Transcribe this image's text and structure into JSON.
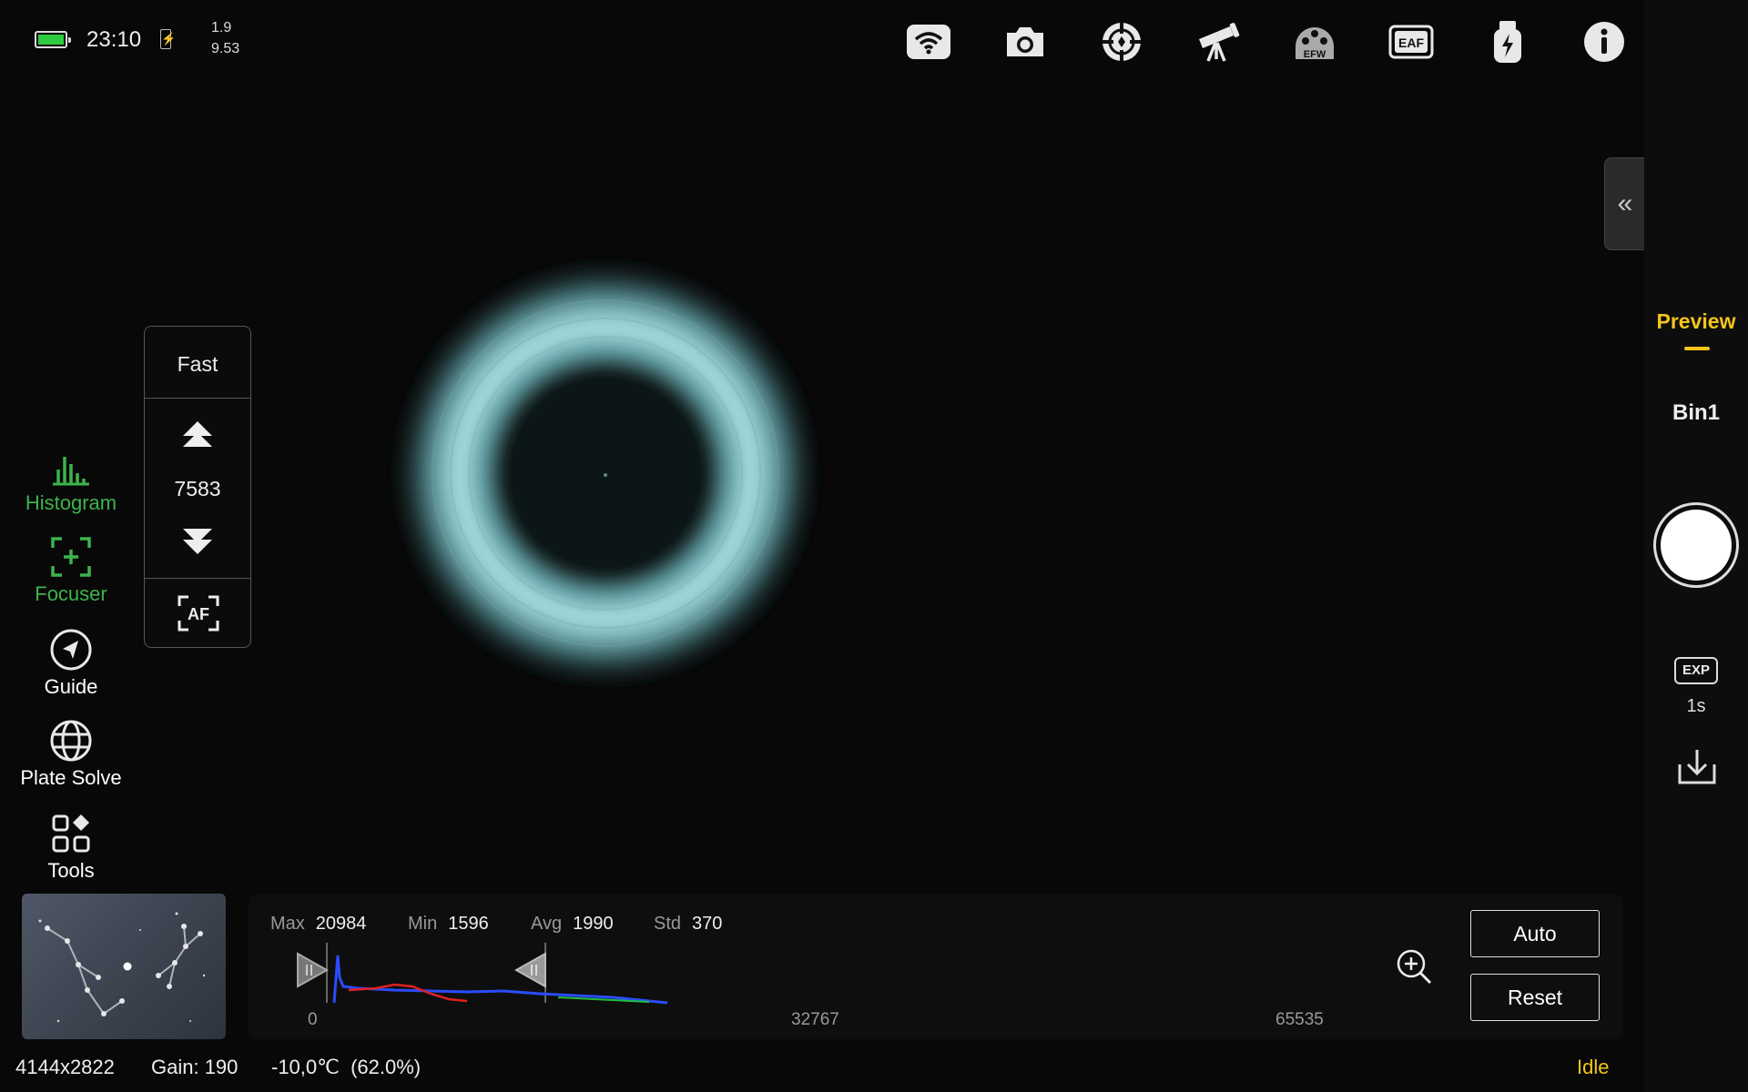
{
  "status": {
    "time": "23:10",
    "value_top": "1.9",
    "value_bottom": "9.53",
    "battery_color": "#2ecc40"
  },
  "top_icons": [
    "wifi-icon",
    "camera-icon",
    "guide-target-icon",
    "telescope-icon",
    "efw-icon",
    "eaf-icon",
    "usb-power-icon",
    "info-icon"
  ],
  "efw_label": "EFW",
  "eaf_label": "EAF",
  "left_menu": {
    "histogram": "Histogram",
    "focuser": "Focuser",
    "guide": "Guide",
    "plate_solve": "Plate Solve",
    "tools": "Tools"
  },
  "focuser_panel": {
    "speed": "Fast",
    "position": "7583",
    "af_label": "AF"
  },
  "right_rail": {
    "mode": "Preview",
    "bin": "Bin1",
    "exp_label": "EXP",
    "exposure": "1s",
    "accent": "#f5c518"
  },
  "histogram": {
    "max_label": "Max",
    "max": "20984",
    "min_label": "Min",
    "min": "1596",
    "avg_label": "Avg",
    "avg": "1990",
    "std_label": "Std",
    "std": "370",
    "axis_left": "0",
    "axis_mid": "32767",
    "axis_right": "65535",
    "auto": "Auto",
    "reset": "Reset"
  },
  "bottom": {
    "resolution": "4144x2822",
    "gain": "Gain: 190",
    "temp": "-10,0℃  (62.0%)",
    "state": "Idle"
  }
}
